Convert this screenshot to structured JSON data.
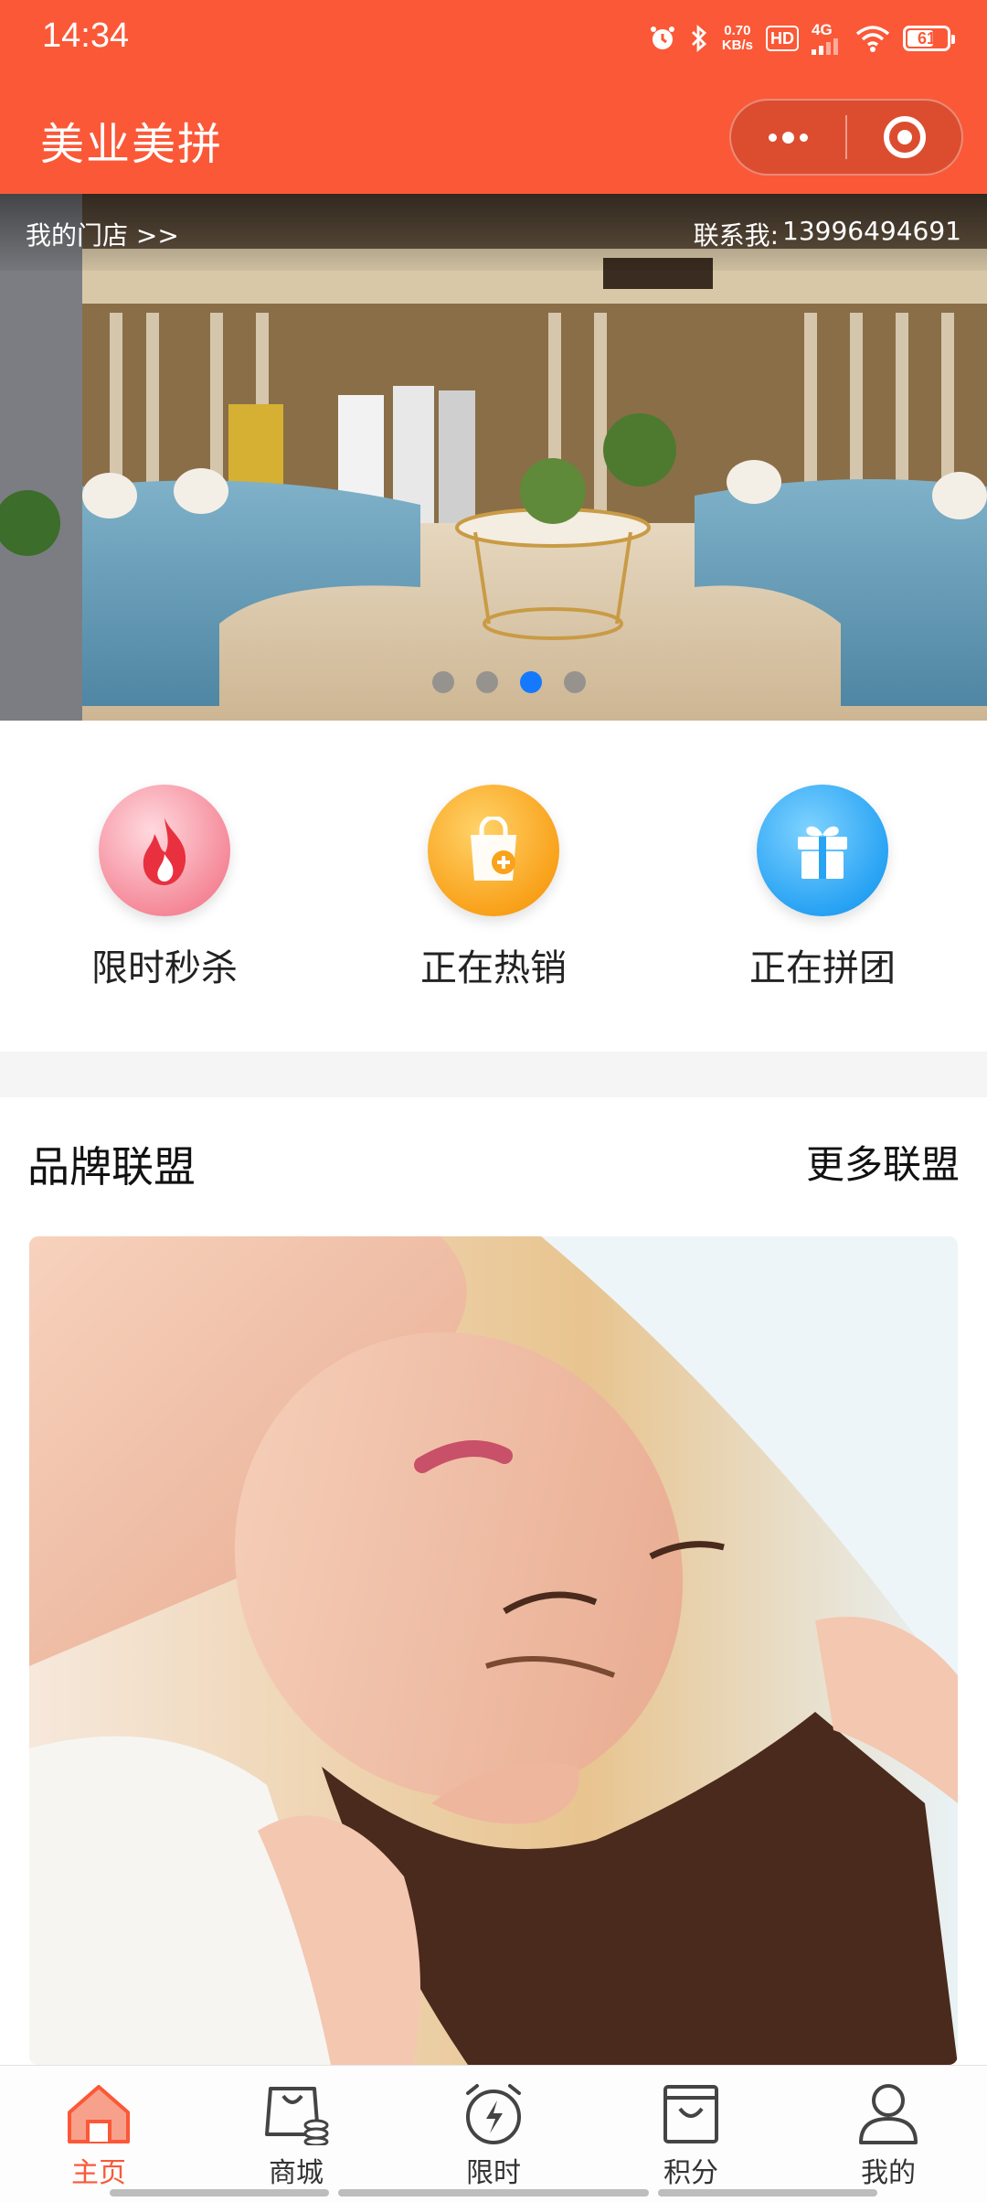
{
  "status_bar": {
    "time": "14:34",
    "speed_value": "0.70",
    "speed_unit": "KB/s",
    "hd": "HD",
    "network": "4G",
    "battery": "61"
  },
  "header": {
    "title": "美业美拼"
  },
  "banner": {
    "my_store": "我的门店 >>",
    "contact_label": "联系我:",
    "contact_phone": "13996494691",
    "page_count": 4,
    "active_page": 3
  },
  "entries": [
    {
      "label": "限时秒杀",
      "icon": "fire-icon",
      "color": "#f27b8c"
    },
    {
      "label": "正在热销",
      "icon": "shopping-bag-add-icon",
      "color": "#f9a21b"
    },
    {
      "label": "正在拼团",
      "icon": "gift-icon",
      "color": "#29a3f4"
    }
  ],
  "brand_section": {
    "title": "品牌联盟",
    "more": "更多联盟"
  },
  "tabbar": {
    "active_color": "#fb5837",
    "items": [
      {
        "label": "主页",
        "icon": "home-icon",
        "active": true
      },
      {
        "label": "商城",
        "icon": "shop-bag-icon",
        "active": false
      },
      {
        "label": "限时",
        "icon": "alarm-clock-icon",
        "active": false
      },
      {
        "label": "积分",
        "icon": "points-bag-icon",
        "active": false
      },
      {
        "label": "我的",
        "icon": "user-icon",
        "active": false
      }
    ]
  },
  "colors": {
    "primary": "#fb5837",
    "pager_active": "#1479ff"
  }
}
